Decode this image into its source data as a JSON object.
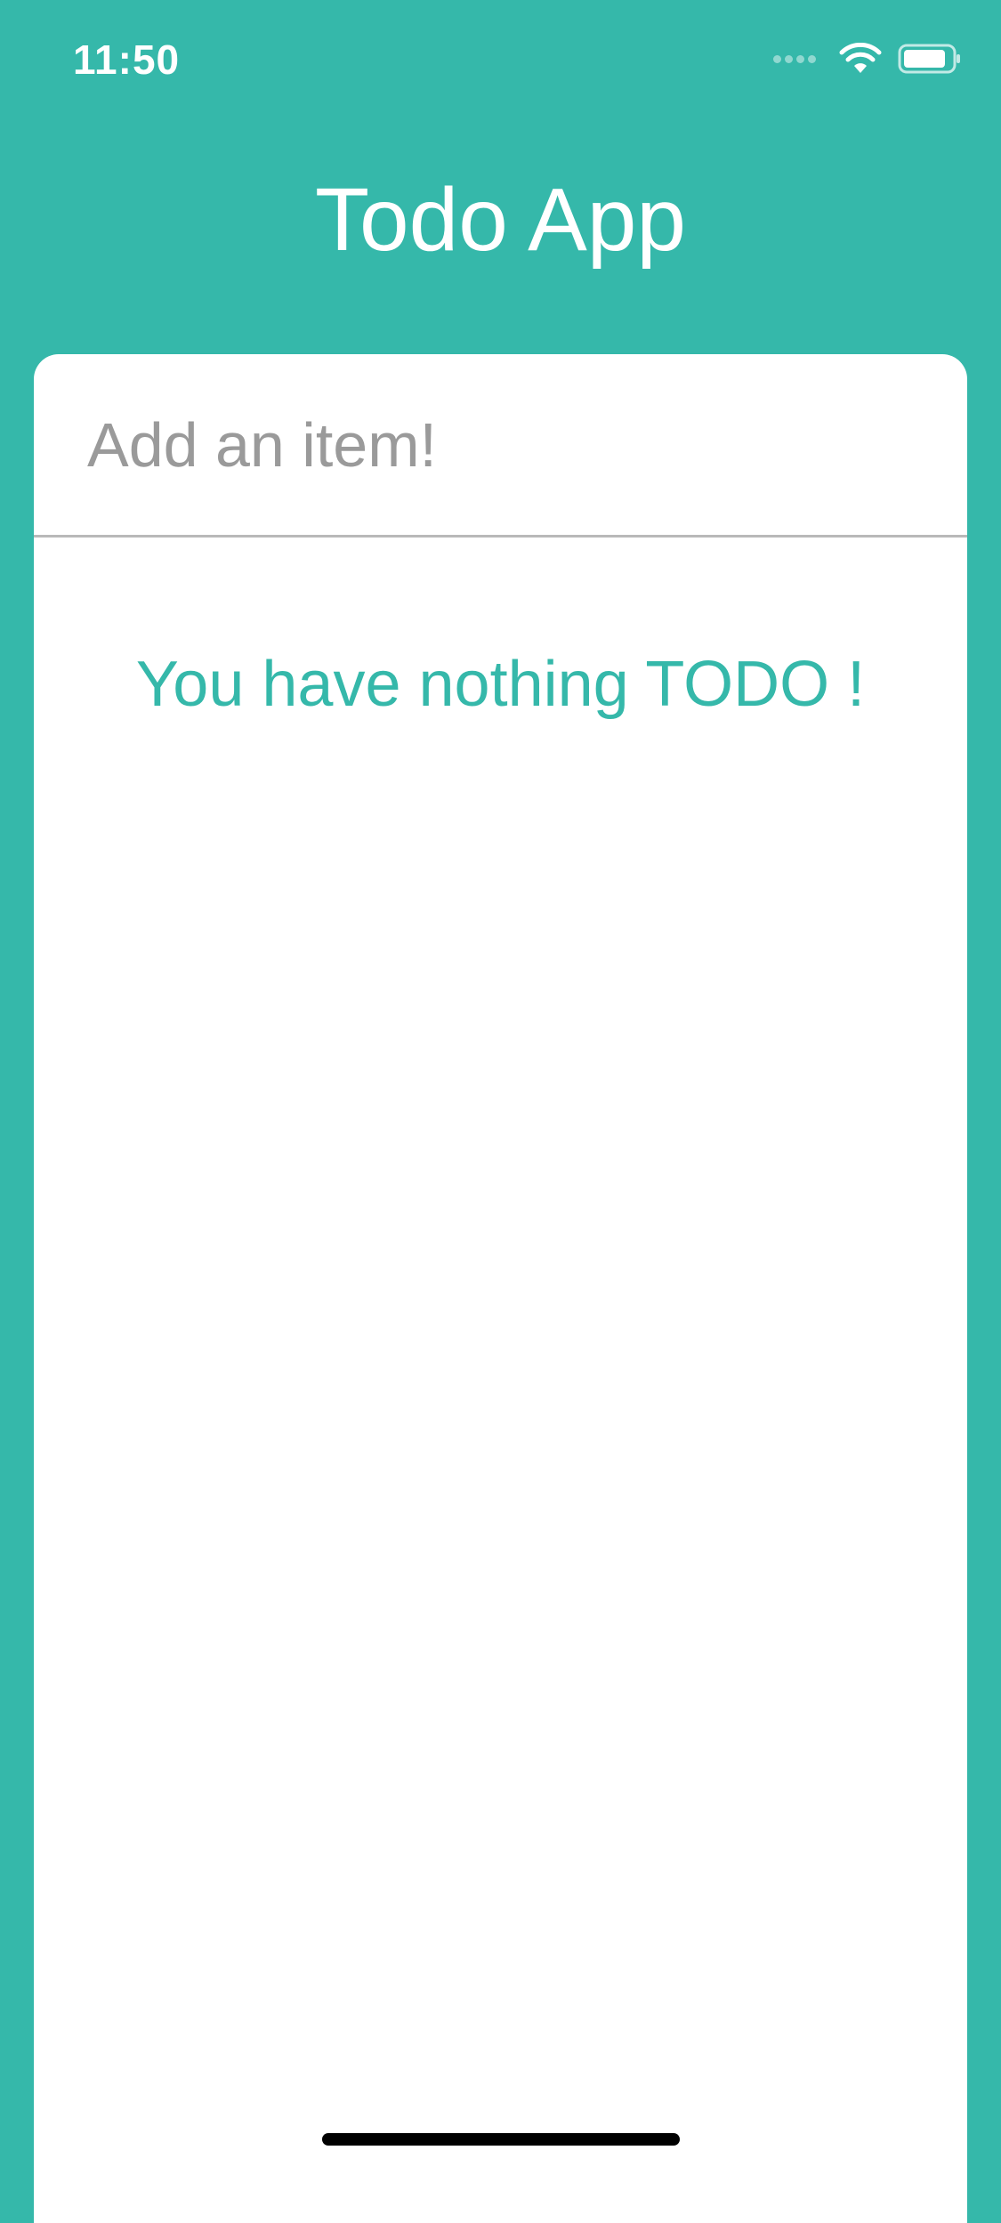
{
  "status_bar": {
    "time": "11:50",
    "icons": [
      "signal-icon",
      "wifi-icon",
      "battery-icon"
    ]
  },
  "header": {
    "title": "Todo App"
  },
  "todo": {
    "input_placeholder": "Add an item!",
    "input_value": "",
    "empty_message": "You have nothing TODO !"
  },
  "colors": {
    "accent": "#35b8aa",
    "card": "#ffffff",
    "placeholder": "#9a9a9a",
    "divider": "#b9b9b9"
  }
}
